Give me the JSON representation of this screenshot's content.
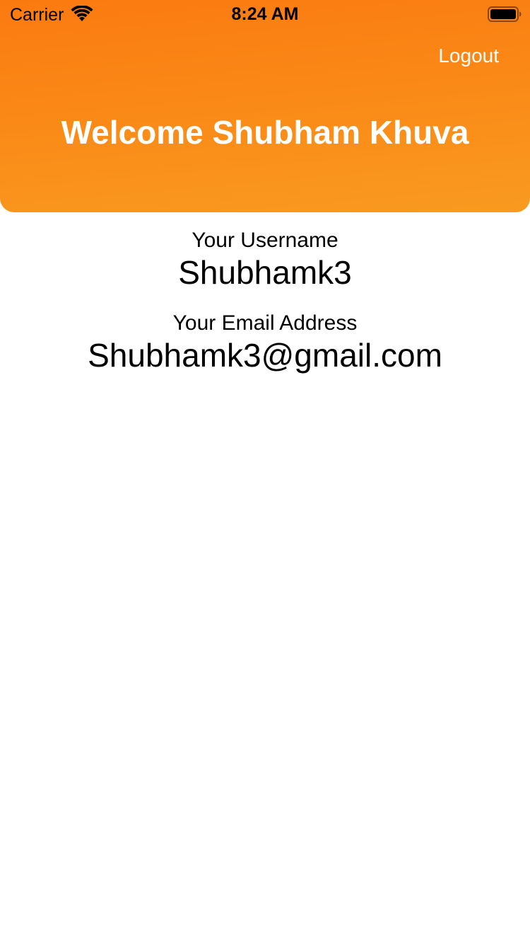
{
  "status_bar": {
    "carrier": "Carrier",
    "time": "8:24 AM",
    "icons": [
      "wifi-icon",
      "battery-icon"
    ]
  },
  "header": {
    "logout_label": "Logout",
    "welcome_title": "Welcome Shubham Khuva",
    "gradient_colors": [
      "#fb7a10",
      "#f99a1f"
    ]
  },
  "profile": {
    "username_label": "Your Username",
    "username_value": "Shubhamk3",
    "email_label": "Your Email Address",
    "email_value": "Shubhamk3@gmail.com"
  }
}
